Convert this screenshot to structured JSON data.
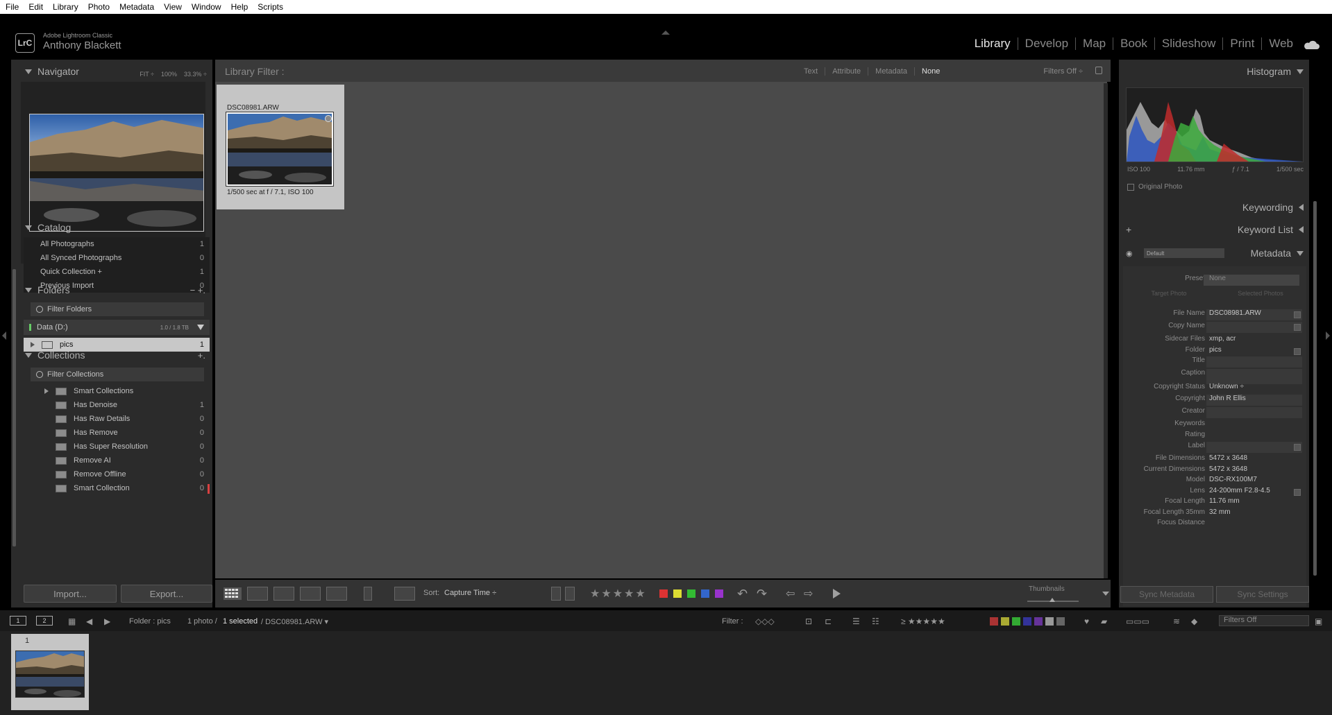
{
  "menu": [
    "File",
    "Edit",
    "Library",
    "Photo",
    "Metadata",
    "View",
    "Window",
    "Help",
    "Scripts"
  ],
  "identity": {
    "logo": "LrC",
    "app_name": "Adobe Lightroom Classic",
    "user": "Anthony Blackett"
  },
  "modules": [
    "Library",
    "Develop",
    "Map",
    "Book",
    "Slideshow",
    "Print",
    "Web"
  ],
  "active_module": "Library",
  "navigator": {
    "title": "Navigator",
    "opts": [
      "FIT ÷",
      "100%",
      "33.3% ÷"
    ]
  },
  "catalog": {
    "title": "Catalog",
    "items": [
      {
        "label": "All Photographs",
        "count": "1"
      },
      {
        "label": "All Synced Photographs",
        "count": "0"
      },
      {
        "label": "Quick Collection  +",
        "count": "1"
      },
      {
        "label": "Previous Import",
        "count": "0"
      }
    ]
  },
  "folders": {
    "title": "Folders",
    "tools": "−  +.",
    "filter_placeholder": "Filter Folders",
    "drive": {
      "label": "Data (D:)",
      "size": "1.0 / 1.8 TB"
    },
    "items": [
      {
        "label": "pics",
        "count": "1"
      }
    ]
  },
  "collections": {
    "title": "Collections",
    "tools": "+.",
    "filter_placeholder": "Filter Collections",
    "set": "Smart Collections",
    "items": [
      {
        "label": "Has Denoise",
        "count": "1"
      },
      {
        "label": "Has Raw Details",
        "count": "0"
      },
      {
        "label": "Has Remove",
        "count": "0"
      },
      {
        "label": "Has Super Resolution",
        "count": "0"
      },
      {
        "label": "Remove AI",
        "count": "0"
      },
      {
        "label": "Remove Offline",
        "count": "0"
      },
      {
        "label": "Smart Collection",
        "count": "0"
      }
    ]
  },
  "buttons": {
    "import": "Import...",
    "export": "Export...",
    "sync_metadata": "Sync Metadata",
    "sync_settings": "Sync Settings"
  },
  "library_filter": {
    "label": "Library Filter :",
    "options": [
      "Text",
      "Attribute",
      "Metadata",
      "None"
    ],
    "active": "None",
    "filters_off": "Filters Off ÷"
  },
  "photo": {
    "file_name": "DSC08981.ARW",
    "exif": "1/500 sec at f / 7.1, ISO 100"
  },
  "toolbar": {
    "sort_label": "Sort:",
    "sort_value": "Capture Time ÷",
    "stars": "★★★★★",
    "thumbnails_label": "Thumbnails",
    "color_labels": [
      "#d33",
      "#dd3",
      "#3b3",
      "#36c",
      "#93c"
    ]
  },
  "histogram": {
    "title": "Histogram",
    "info": [
      "ISO 100",
      "11.76 mm",
      "ƒ / 7.1",
      "1/500 sec"
    ],
    "original_photo": "Original Photo"
  },
  "right_panels": {
    "keywording": "Keywording",
    "keyword_list": "Keyword List",
    "metadata": "Metadata",
    "preset_default": "Default"
  },
  "metadata": {
    "target_photo": "Target Photo",
    "selected_photos": "Selected Photos",
    "preset": {
      "k": "Preset",
      "v": "None"
    },
    "rows": [
      {
        "k": "File Name",
        "v": "DSC08981.ARW"
      },
      {
        "k": "Copy Name",
        "v": ""
      },
      {
        "k": "Sidecar Files",
        "v": "xmp, acr"
      },
      {
        "k": "Folder",
        "v": "pics"
      },
      {
        "k": "Title",
        "v": ""
      },
      {
        "k": "Caption",
        "v": ""
      },
      {
        "k": "Copyright Status",
        "v": "Unknown ÷"
      },
      {
        "k": "Copyright",
        "v": "John R Ellis"
      },
      {
        "k": "Creator",
        "v": ""
      },
      {
        "k": "Keywords",
        "v": ""
      },
      {
        "k": "Rating",
        "v": ""
      },
      {
        "k": "Label",
        "v": ""
      },
      {
        "k": "File Dimensions",
        "v": "5472 x 3648"
      },
      {
        "k": "Current Dimensions",
        "v": "5472 x 3648"
      },
      {
        "k": "Model",
        "v": "DSC-RX100M7"
      },
      {
        "k": "Lens",
        "v": "24-200mm F2.8-4.5"
      },
      {
        "k": "Focal Length",
        "v": "11.76 mm"
      },
      {
        "k": "Focal Length 35mm",
        "v": "32 mm"
      },
      {
        "k": "Focus Distance",
        "v": ""
      }
    ]
  },
  "filmstrip": {
    "screen1": "1",
    "screen2": "2",
    "folder": "Folder : pics",
    "count": "1 photo /",
    "selected": "1 selected",
    "file": "/ DSC08981.ARW ▾",
    "filter_label": "Filter :",
    "filters_off": "Filters Off",
    "cell_number": "1",
    "stars": "≥ ★★★★★",
    "color_labels": [
      "#a33",
      "#aa3",
      "#3a3",
      "#339",
      "#639",
      "#999",
      "#666"
    ]
  },
  "colors": {
    "accent": "#e6e6e6",
    "panel": "#2b2b2b",
    "grid": "#4a4a4a"
  }
}
